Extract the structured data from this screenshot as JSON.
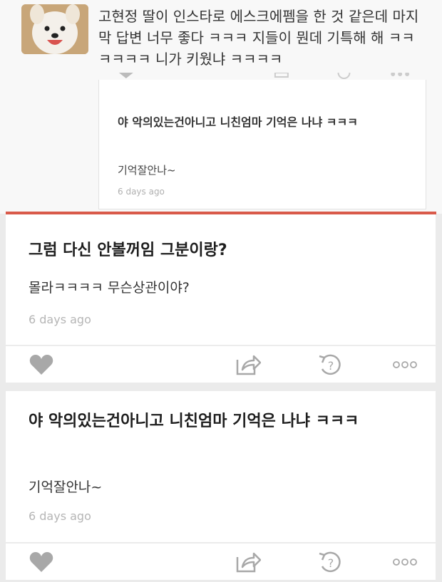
{
  "top_comment": {
    "text": "고현정 딸이 인스타로 에스크에펨을 한 것 같은데 마지막 답변 너무 좋다 ㅋㅋㅋ 지들이 뭔데 기특해 해 ㅋㅋㅋㅋㅋㅋ 니가 키웠냐 ㅋㅋㅋㅋ",
    "quote": {
      "title": "야 악의있는건아니고 니친엄마 기억은 나냐 ㅋㅋㅋ",
      "body": "기억잘안나~",
      "time": "6 days ago"
    }
  },
  "posts": [
    {
      "title": "그럼 다신 안볼꺼임 그분이랑?",
      "body": "몰라ㅋㅋㅋㅋ 무슨상관이야?",
      "time": "6 days ago"
    },
    {
      "title": "야 악의있는건아니고 니친엄마 기억은 나냐 ㅋㅋㅋ",
      "body": "기억잘안나~",
      "time": "6 days ago"
    }
  ],
  "icons": [
    "heart-icon",
    "share-icon",
    "question-icon",
    "more-icon"
  ],
  "colors": {
    "accent_divider": "#d95a4a",
    "icon_gray": "#a8a8a8"
  }
}
